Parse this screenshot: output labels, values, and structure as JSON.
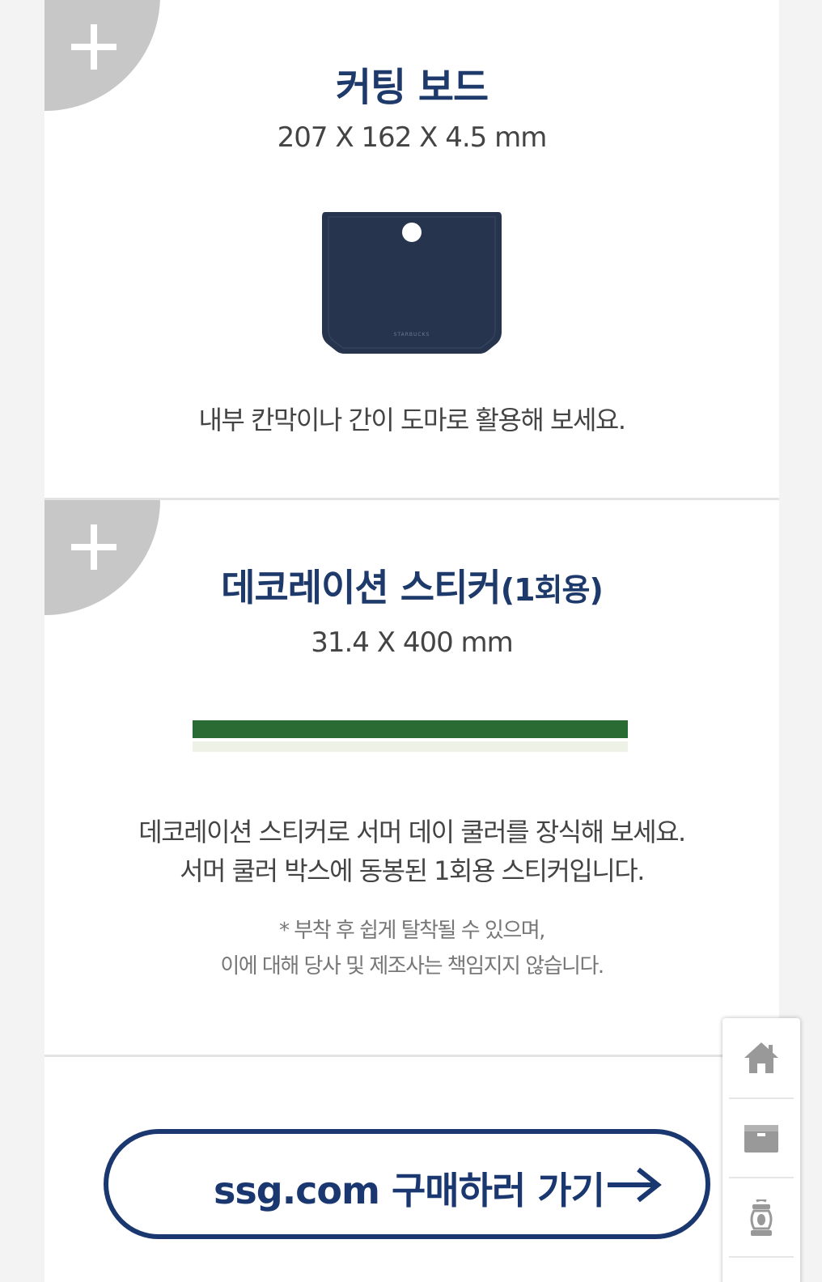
{
  "products": [
    {
      "title": "커팅 보드",
      "dimensions": "207 X 162 X 4.5 mm",
      "image_text": "STARBUCKS",
      "description": "내부 칸막이나 간이 도마로 활용해 보세요."
    },
    {
      "title_main": "데코레이션 스티커",
      "title_suffix": "(1회용)",
      "dimensions": "31.4 X 400 mm",
      "description_lines": [
        "데코레이션 스티커로 서머 데이 쿨러를 장식해 보세요.",
        "서머 쿨러 박스에 동봉된 1회용 스티커입니다."
      ],
      "note_lines": [
        "* 부착 후 쉽게 탈착될 수 있으며,",
        "이에 대해 당사 및 제조사는 책임지지 않습니다."
      ]
    }
  ],
  "cta": {
    "label": "ssg.com 구매하러 가기"
  },
  "floating_nav": {
    "icons": [
      "home-icon",
      "box-icon",
      "lantern-icon",
      "more-icon"
    ]
  },
  "colors": {
    "brand_navy": "#1e3a6b",
    "board_navy": "#27344d",
    "sticker_green": "#2a6b33",
    "sticker_backing": "#eef2e6",
    "badge_gray": "#c7c7c7"
  }
}
